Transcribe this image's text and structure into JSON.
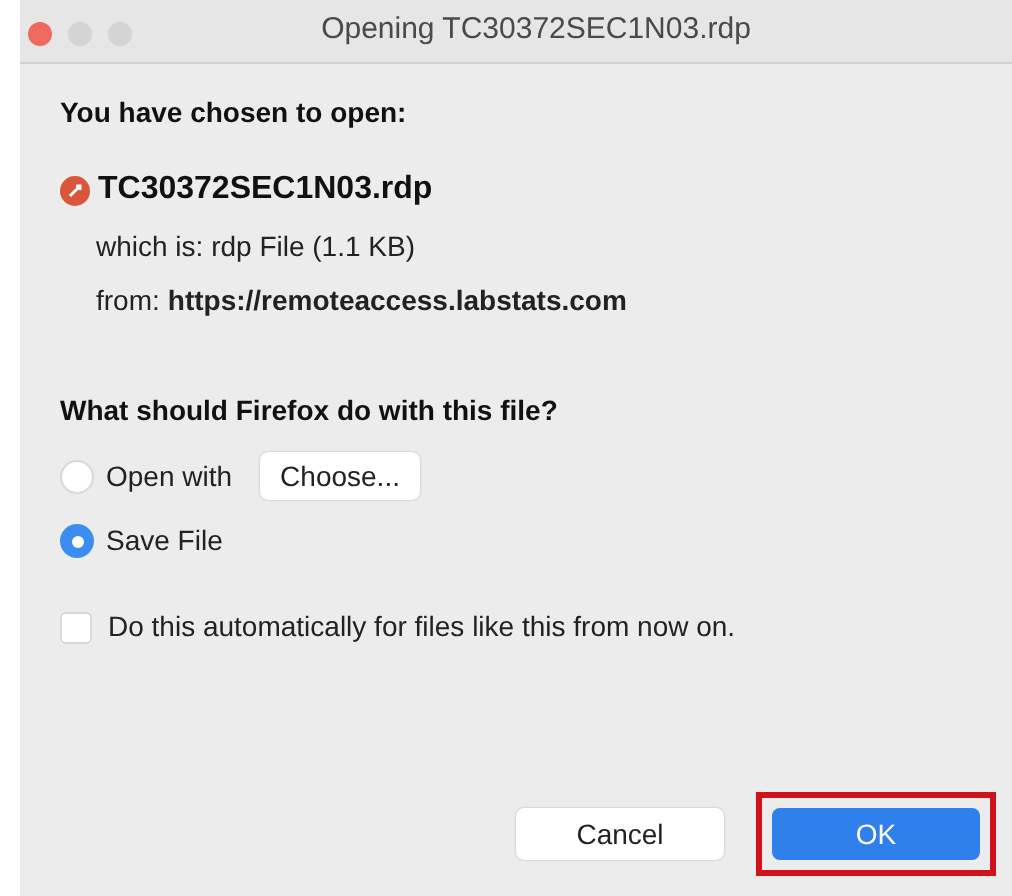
{
  "window": {
    "title": "Opening TC30372SEC1N03.rdp"
  },
  "heading": "You have chosen to open:",
  "file": {
    "name": "TC30372SEC1N03.rdp",
    "type_line": "which is: rdp File (1.1 KB)",
    "from_label": "from:",
    "from_url": "https://remoteaccess.labstats.com"
  },
  "question": "What should Firefox do with this file?",
  "options": [
    {
      "label": "Open with",
      "selected": false,
      "button": "Choose..."
    },
    {
      "label": "Save File",
      "selected": true
    }
  ],
  "auto": {
    "label": "Do this automatically for files like this from now on.",
    "checked": false
  },
  "buttons": [
    {
      "label": "Cancel",
      "kind": "default",
      "highlighted": false
    },
    {
      "label": "OK",
      "kind": "primary",
      "highlighted": true
    }
  ]
}
